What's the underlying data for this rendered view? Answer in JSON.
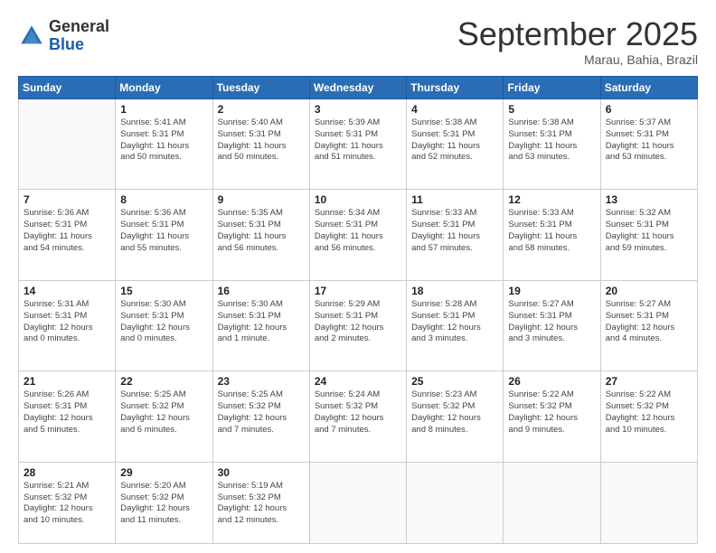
{
  "header": {
    "logo_general": "General",
    "logo_blue": "Blue",
    "month_title": "September 2025",
    "location": "Marau, Bahia, Brazil"
  },
  "weekdays": [
    "Sunday",
    "Monday",
    "Tuesday",
    "Wednesday",
    "Thursday",
    "Friday",
    "Saturday"
  ],
  "weeks": [
    [
      {
        "day": "",
        "info": ""
      },
      {
        "day": "1",
        "info": "Sunrise: 5:41 AM\nSunset: 5:31 PM\nDaylight: 11 hours\nand 50 minutes."
      },
      {
        "day": "2",
        "info": "Sunrise: 5:40 AM\nSunset: 5:31 PM\nDaylight: 11 hours\nand 50 minutes."
      },
      {
        "day": "3",
        "info": "Sunrise: 5:39 AM\nSunset: 5:31 PM\nDaylight: 11 hours\nand 51 minutes."
      },
      {
        "day": "4",
        "info": "Sunrise: 5:38 AM\nSunset: 5:31 PM\nDaylight: 11 hours\nand 52 minutes."
      },
      {
        "day": "5",
        "info": "Sunrise: 5:38 AM\nSunset: 5:31 PM\nDaylight: 11 hours\nand 53 minutes."
      },
      {
        "day": "6",
        "info": "Sunrise: 5:37 AM\nSunset: 5:31 PM\nDaylight: 11 hours\nand 53 minutes."
      }
    ],
    [
      {
        "day": "7",
        "info": "Sunrise: 5:36 AM\nSunset: 5:31 PM\nDaylight: 11 hours\nand 54 minutes."
      },
      {
        "day": "8",
        "info": "Sunrise: 5:36 AM\nSunset: 5:31 PM\nDaylight: 11 hours\nand 55 minutes."
      },
      {
        "day": "9",
        "info": "Sunrise: 5:35 AM\nSunset: 5:31 PM\nDaylight: 11 hours\nand 56 minutes."
      },
      {
        "day": "10",
        "info": "Sunrise: 5:34 AM\nSunset: 5:31 PM\nDaylight: 11 hours\nand 56 minutes."
      },
      {
        "day": "11",
        "info": "Sunrise: 5:33 AM\nSunset: 5:31 PM\nDaylight: 11 hours\nand 57 minutes."
      },
      {
        "day": "12",
        "info": "Sunrise: 5:33 AM\nSunset: 5:31 PM\nDaylight: 11 hours\nand 58 minutes."
      },
      {
        "day": "13",
        "info": "Sunrise: 5:32 AM\nSunset: 5:31 PM\nDaylight: 11 hours\nand 59 minutes."
      }
    ],
    [
      {
        "day": "14",
        "info": "Sunrise: 5:31 AM\nSunset: 5:31 PM\nDaylight: 12 hours\nand 0 minutes."
      },
      {
        "day": "15",
        "info": "Sunrise: 5:30 AM\nSunset: 5:31 PM\nDaylight: 12 hours\nand 0 minutes."
      },
      {
        "day": "16",
        "info": "Sunrise: 5:30 AM\nSunset: 5:31 PM\nDaylight: 12 hours\nand 1 minute."
      },
      {
        "day": "17",
        "info": "Sunrise: 5:29 AM\nSunset: 5:31 PM\nDaylight: 12 hours\nand 2 minutes."
      },
      {
        "day": "18",
        "info": "Sunrise: 5:28 AM\nSunset: 5:31 PM\nDaylight: 12 hours\nand 3 minutes."
      },
      {
        "day": "19",
        "info": "Sunrise: 5:27 AM\nSunset: 5:31 PM\nDaylight: 12 hours\nand 3 minutes."
      },
      {
        "day": "20",
        "info": "Sunrise: 5:27 AM\nSunset: 5:31 PM\nDaylight: 12 hours\nand 4 minutes."
      }
    ],
    [
      {
        "day": "21",
        "info": "Sunrise: 5:26 AM\nSunset: 5:31 PM\nDaylight: 12 hours\nand 5 minutes."
      },
      {
        "day": "22",
        "info": "Sunrise: 5:25 AM\nSunset: 5:32 PM\nDaylight: 12 hours\nand 6 minutes."
      },
      {
        "day": "23",
        "info": "Sunrise: 5:25 AM\nSunset: 5:32 PM\nDaylight: 12 hours\nand 7 minutes."
      },
      {
        "day": "24",
        "info": "Sunrise: 5:24 AM\nSunset: 5:32 PM\nDaylight: 12 hours\nand 7 minutes."
      },
      {
        "day": "25",
        "info": "Sunrise: 5:23 AM\nSunset: 5:32 PM\nDaylight: 12 hours\nand 8 minutes."
      },
      {
        "day": "26",
        "info": "Sunrise: 5:22 AM\nSunset: 5:32 PM\nDaylight: 12 hours\nand 9 minutes."
      },
      {
        "day": "27",
        "info": "Sunrise: 5:22 AM\nSunset: 5:32 PM\nDaylight: 12 hours\nand 10 minutes."
      }
    ],
    [
      {
        "day": "28",
        "info": "Sunrise: 5:21 AM\nSunset: 5:32 PM\nDaylight: 12 hours\nand 10 minutes."
      },
      {
        "day": "29",
        "info": "Sunrise: 5:20 AM\nSunset: 5:32 PM\nDaylight: 12 hours\nand 11 minutes."
      },
      {
        "day": "30",
        "info": "Sunrise: 5:19 AM\nSunset: 5:32 PM\nDaylight: 12 hours\nand 12 minutes."
      },
      {
        "day": "",
        "info": ""
      },
      {
        "day": "",
        "info": ""
      },
      {
        "day": "",
        "info": ""
      },
      {
        "day": "",
        "info": ""
      }
    ]
  ]
}
